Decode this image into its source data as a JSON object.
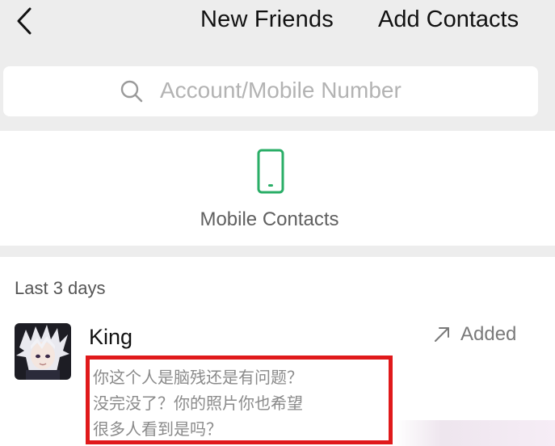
{
  "header": {
    "back_icon": "chevron-left-icon",
    "title": "New Friends",
    "add_contacts_label": "Add Contacts"
  },
  "search": {
    "icon": "search-icon",
    "placeholder": "Account/Mobile Number"
  },
  "mobile_contacts": {
    "icon": "phone-icon",
    "icon_color": "#2aae67",
    "label": "Mobile Contacts"
  },
  "section": {
    "label": "Last 3 days"
  },
  "requests": [
    {
      "name": "King",
      "status_icon": "arrow-up-right-icon",
      "status": "Added",
      "message_lines": [
        "你这个人是脑残还是有问题？",
        "没完没了？你的照片你也希望",
        "很多人看到是吗？"
      ],
      "highlight_color": "#e0191b"
    }
  ]
}
